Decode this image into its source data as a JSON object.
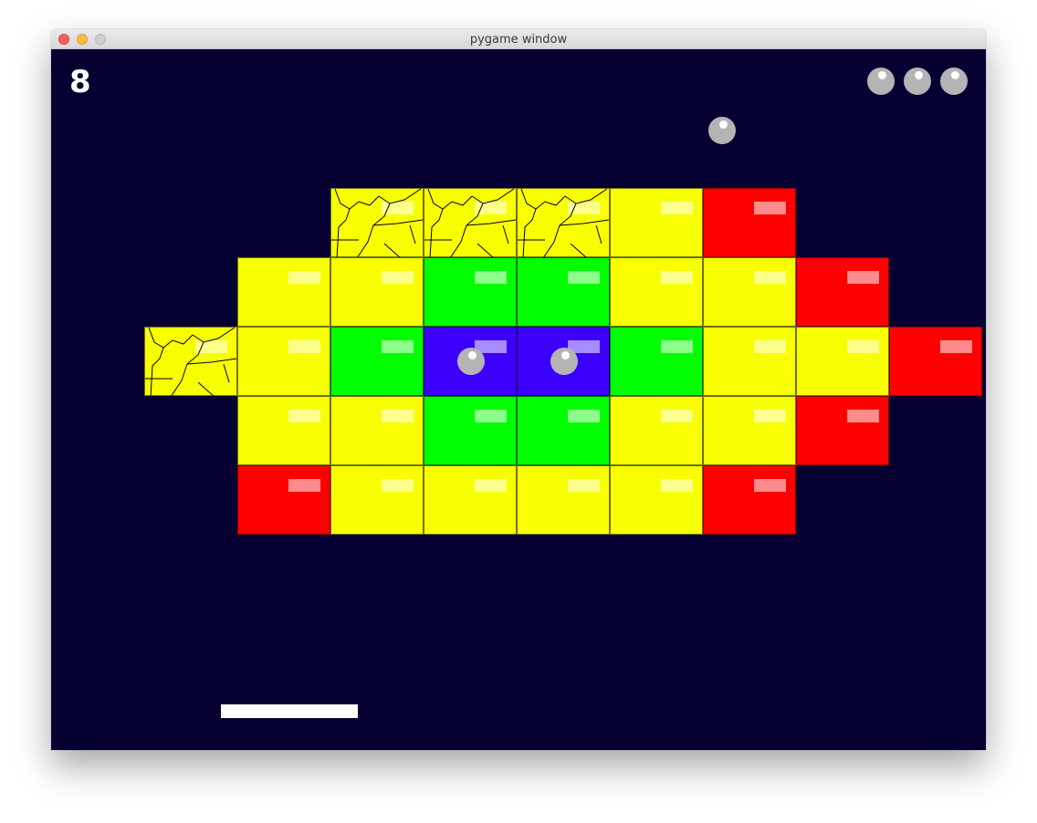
{
  "window": {
    "title": "pygame window"
  },
  "hud": {
    "score": "8",
    "lives_remaining": 3
  },
  "colors": {
    "background": "#060032",
    "yellow": "#f8ff00",
    "green": "#00ff00",
    "blue": "#3c00ff",
    "red": "#ff0000",
    "ball": "#b4b4b4",
    "paddle": "#ffffff"
  },
  "bricks": [
    {
      "row": 0,
      "col": 2,
      "color": "yellow",
      "cracked": true
    },
    {
      "row": 0,
      "col": 3,
      "color": "yellow",
      "cracked": true
    },
    {
      "row": 0,
      "col": 4,
      "color": "yellow",
      "cracked": true
    },
    {
      "row": 0,
      "col": 5,
      "color": "yellow",
      "cracked": false
    },
    {
      "row": 0,
      "col": 6,
      "color": "red",
      "cracked": false
    },
    {
      "row": 1,
      "col": 1,
      "color": "yellow",
      "cracked": false
    },
    {
      "row": 1,
      "col": 2,
      "color": "yellow",
      "cracked": false
    },
    {
      "row": 1,
      "col": 3,
      "color": "green",
      "cracked": false
    },
    {
      "row": 1,
      "col": 4,
      "color": "green",
      "cracked": false
    },
    {
      "row": 1,
      "col": 5,
      "color": "yellow",
      "cracked": false
    },
    {
      "row": 1,
      "col": 6,
      "color": "yellow",
      "cracked": false
    },
    {
      "row": 1,
      "col": 7,
      "color": "red",
      "cracked": false
    },
    {
      "row": 2,
      "col": 0,
      "color": "yellow",
      "cracked": true
    },
    {
      "row": 2,
      "col": 1,
      "color": "yellow",
      "cracked": false
    },
    {
      "row": 2,
      "col": 2,
      "color": "green",
      "cracked": false
    },
    {
      "row": 2,
      "col": 3,
      "color": "blue",
      "cracked": false,
      "has_ball": true
    },
    {
      "row": 2,
      "col": 4,
      "color": "blue",
      "cracked": false,
      "has_ball": true
    },
    {
      "row": 2,
      "col": 5,
      "color": "green",
      "cracked": false
    },
    {
      "row": 2,
      "col": 6,
      "color": "yellow",
      "cracked": false
    },
    {
      "row": 2,
      "col": 7,
      "color": "yellow",
      "cracked": false
    },
    {
      "row": 2,
      "col": 8,
      "color": "red",
      "cracked": false
    },
    {
      "row": 3,
      "col": 1,
      "color": "yellow",
      "cracked": false
    },
    {
      "row": 3,
      "col": 2,
      "color": "yellow",
      "cracked": false
    },
    {
      "row": 3,
      "col": 3,
      "color": "green",
      "cracked": false
    },
    {
      "row": 3,
      "col": 4,
      "color": "green",
      "cracked": false
    },
    {
      "row": 3,
      "col": 5,
      "color": "yellow",
      "cracked": false
    },
    {
      "row": 3,
      "col": 6,
      "color": "yellow",
      "cracked": false
    },
    {
      "row": 3,
      "col": 7,
      "color": "red",
      "cracked": false
    },
    {
      "row": 4,
      "col": 1,
      "color": "red",
      "cracked": false
    },
    {
      "row": 4,
      "col": 2,
      "color": "yellow",
      "cracked": false
    },
    {
      "row": 4,
      "col": 3,
      "color": "yellow",
      "cracked": false
    },
    {
      "row": 4,
      "col": 4,
      "color": "yellow",
      "cracked": false
    },
    {
      "row": 4,
      "col": 5,
      "color": "yellow",
      "cracked": false
    },
    {
      "row": 4,
      "col": 6,
      "color": "red",
      "cracked": false
    }
  ]
}
